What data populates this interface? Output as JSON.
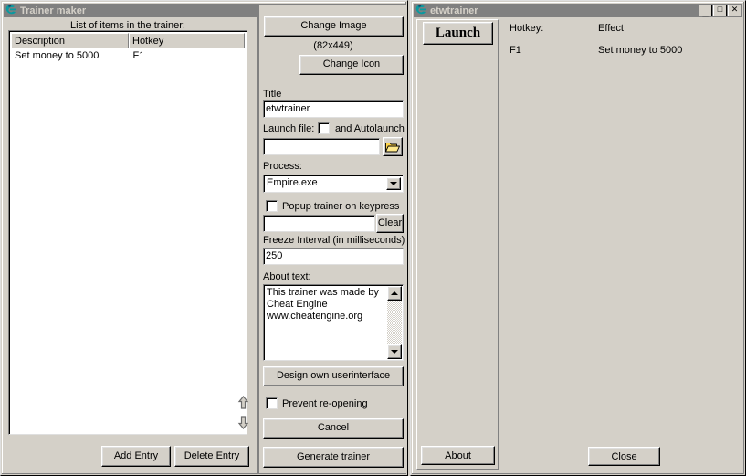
{
  "maker_window": {
    "title": "Trainer maker",
    "icon": "cheat-engine-logo-icon",
    "close_label": "✕",
    "list_caption": "List of items in the trainer:",
    "list": {
      "columns": [
        "Description",
        "Hotkey"
      ],
      "rows": [
        {
          "description": "Set money to 5000",
          "hotkey": "F1"
        }
      ]
    },
    "reorder": {
      "up_icon": "arrow-up-icon",
      "down_icon": "arrow-down-icon"
    },
    "buttons": {
      "add_entry": "Add Entry",
      "delete_entry": "Delete Entry"
    },
    "form": {
      "change_image": "Change Image",
      "image_size": "(82x449)",
      "change_icon": "Change Icon",
      "title_label": "Title",
      "title_value": "etwtrainer",
      "launch_file_label": "Launch file:",
      "autolaunch_label": "and Autolaunch",
      "autolaunch_checked": false,
      "launch_file_value": "",
      "browse_icon": "open-folder-icon",
      "process_label": "Process:",
      "process_value": "Empire.exe",
      "process_options": [
        "Empire.exe"
      ],
      "popup_label": "Popup trainer on keypress",
      "popup_checked": false,
      "popup_key_value": "",
      "clear_label": "Clear",
      "freeze_label": "Freeze Interval (in milliseconds)",
      "freeze_value": "250",
      "about_label": "About text:",
      "about_value": "This trainer was made by\nCheat Engine\nwww.cheatengine.org",
      "design_ui": "Design own userinterface",
      "prevent_reopening_label": "Prevent re-opening",
      "prevent_reopening_checked": false,
      "cancel": "Cancel",
      "generate": "Generate trainer"
    }
  },
  "trainer_window": {
    "title": "etwtrainer",
    "icon": "cheat-engine-logo-icon",
    "minimize_label": "_",
    "maximize_label": "□",
    "close_label": "✕",
    "launch_label": "Launch",
    "about_label": "About",
    "close_button_label": "Close",
    "columns": {
      "hotkey": "Hotkey:",
      "effect": "Effect"
    },
    "rows": [
      {
        "hotkey": "F1",
        "effect": "Set money to 5000"
      }
    ]
  },
  "colors": {
    "face": "#d4d0c8",
    "titlebar_inactive": "#808080",
    "titlebar_text": "#d4d0c8",
    "field": "#ffffff",
    "logo_teal": "#008080"
  }
}
